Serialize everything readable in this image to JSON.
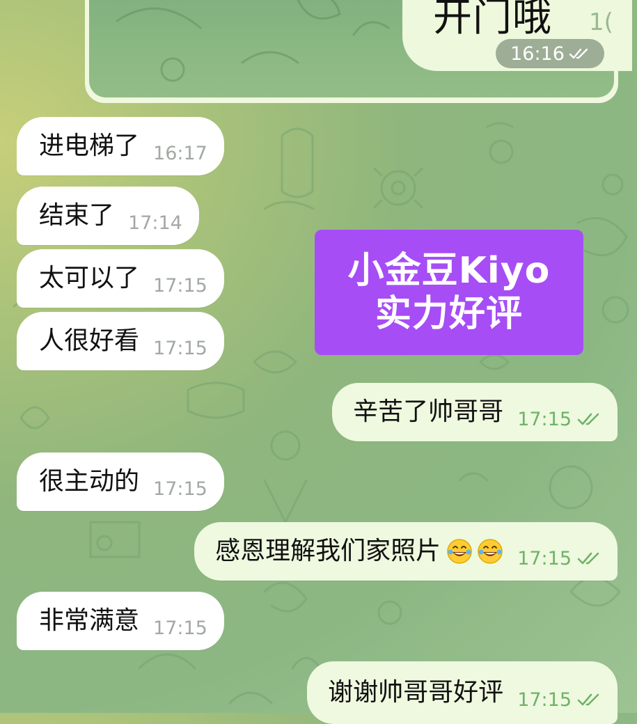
{
  "top_image_message": {
    "text": "开门哦",
    "partial_time": "1(",
    "time": "16:16"
  },
  "messages": [
    {
      "id": "m1",
      "text": "进电梯了",
      "time": "16:17"
    },
    {
      "id": "m2",
      "text": "结束了",
      "time": "17:14"
    },
    {
      "id": "m3",
      "text": "太可以了",
      "time": "17:15"
    },
    {
      "id": "m4",
      "text": "人很好看",
      "time": "17:15"
    },
    {
      "id": "m5",
      "text": "辛苦了帅哥哥",
      "time": "17:15"
    },
    {
      "id": "m6",
      "text": "很主动的",
      "time": "17:15"
    },
    {
      "id": "m7",
      "text": "感恩理解我们家照片",
      "time": "17:15"
    },
    {
      "id": "m8",
      "text": "非常满意",
      "time": "17:15"
    },
    {
      "id": "m9",
      "text": "谢谢帅哥哥好评",
      "time": "17:15"
    }
  ],
  "promo_overlay": {
    "line1": "小金豆Kiyo",
    "line2": "实力好评"
  },
  "colors": {
    "incoming_bubble": "#ffffff",
    "outgoing_bubble": "#eef9df",
    "promo_background": "#a64df6",
    "read_ticks": "#6fb267"
  }
}
